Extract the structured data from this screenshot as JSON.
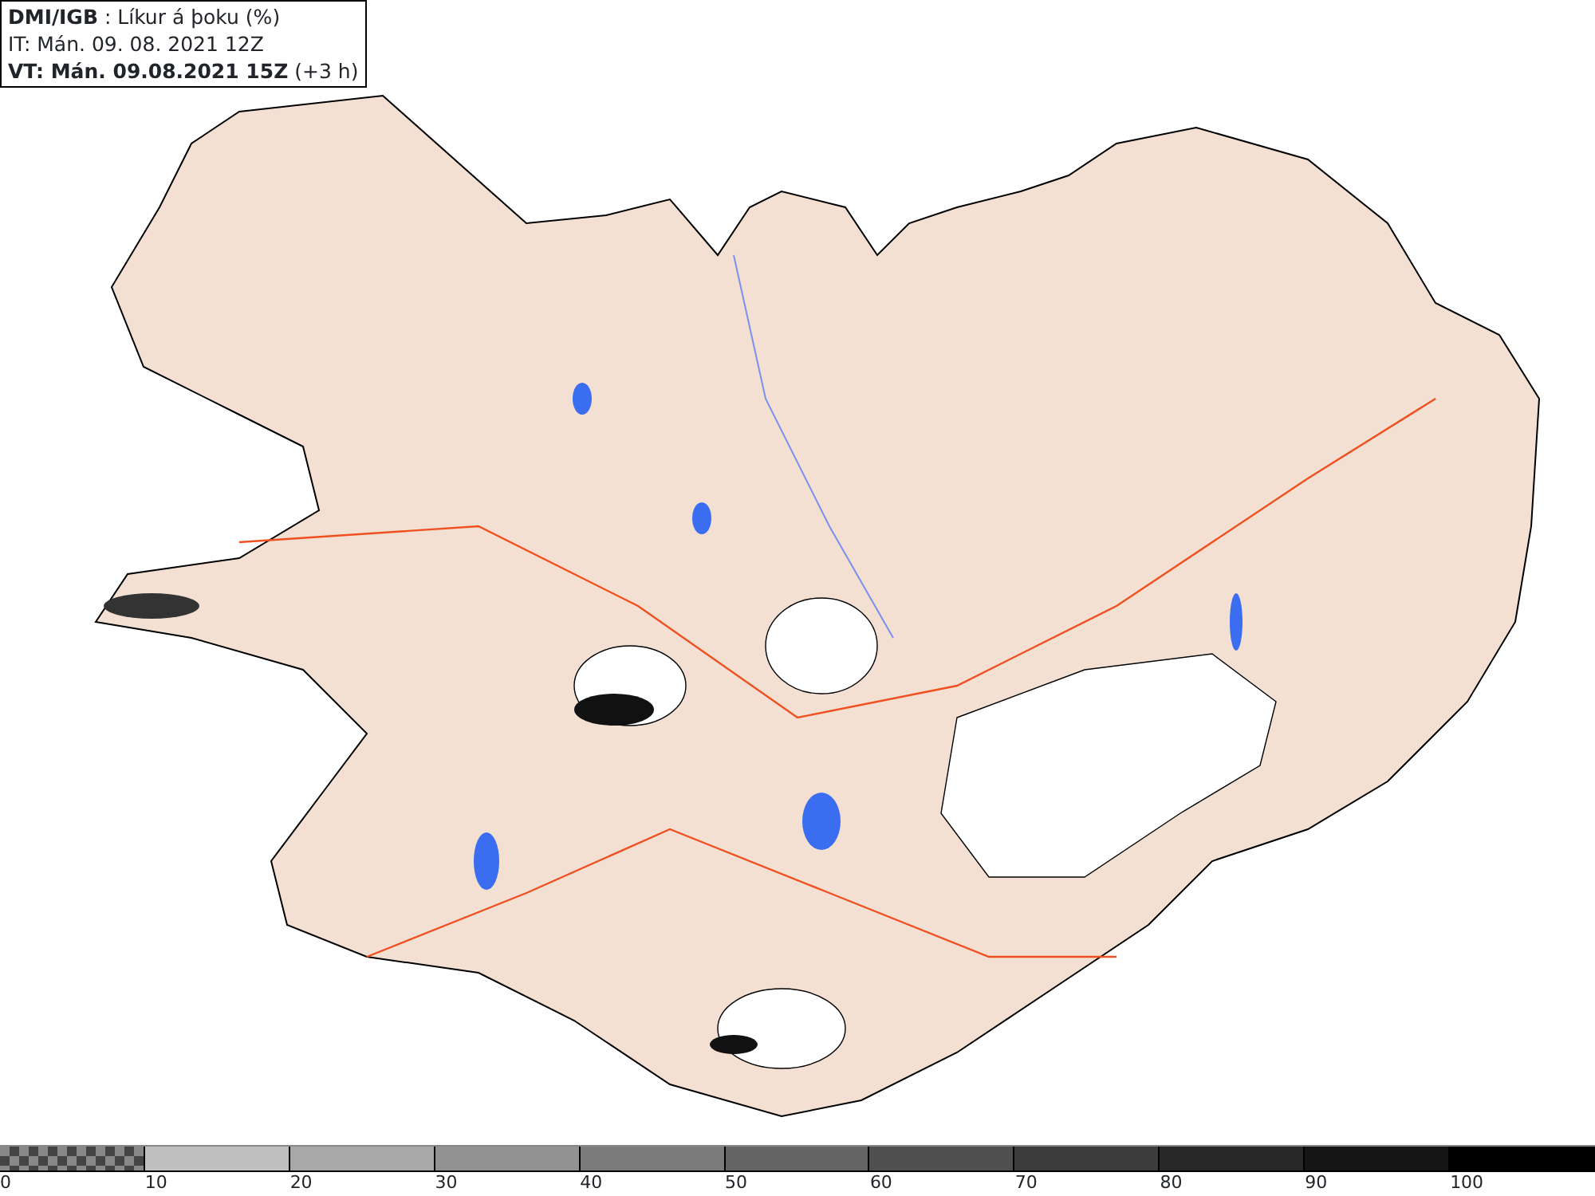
{
  "header": {
    "source": "DMI/IGB",
    "title": " : Líkur á þoku (%)",
    "issue_time": "IT: Mán. 09. 08. 2021 12Z",
    "valid_time": "VT: Mán. 09.08.2021 15Z",
    "lead": " (+3 h)"
  },
  "legend": [
    {
      "label": "0",
      "color": "#888888",
      "kind": "checker"
    },
    {
      "label": "10",
      "color": "#c0c0c0"
    },
    {
      "label": "20",
      "color": "#a8a8a8"
    },
    {
      "label": "30",
      "color": "#929292"
    },
    {
      "label": "40",
      "color": "#7b7b7b"
    },
    {
      "label": "50",
      "color": "#646464"
    },
    {
      "label": "60",
      "color": "#505050"
    },
    {
      "label": "70",
      "color": "#3c3c3c"
    },
    {
      "label": "80",
      "color": "#282828"
    },
    {
      "label": "90",
      "color": "#141414"
    },
    {
      "label": "100",
      "color": "#000000"
    }
  ]
}
